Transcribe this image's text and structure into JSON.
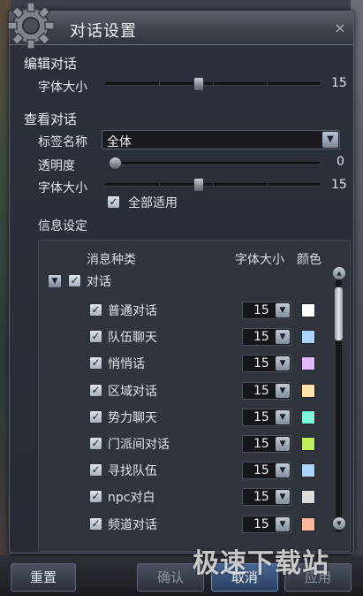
{
  "window": {
    "title": "对话设置",
    "close_glyph": "×"
  },
  "edit_chat": {
    "title": "编辑对话",
    "font_size_label": "字体大小",
    "font_size_value": "15",
    "font_size_fraction": 0.43
  },
  "view_chat": {
    "title": "查看对话",
    "tab_name_label": "标签名称",
    "tab_name_value": "全体",
    "opacity_label": "透明度",
    "opacity_value": "0",
    "opacity_fraction": 0.0,
    "font_size_label": "字体大小",
    "font_size_value": "15",
    "font_size_fraction": 0.43,
    "apply_all_label": "全部适用",
    "apply_all_checked": true
  },
  "info": {
    "title": "信息设定",
    "col_type": "消息种类",
    "col_font": "字体大小",
    "col_color": "颜色",
    "group_label": "对话",
    "group_checked": true,
    "rows": [
      {
        "label": "普通对话",
        "size": "15",
        "color": "#ffffff"
      },
      {
        "label": "队伍聊天",
        "size": "15",
        "color": "#a8d4ff"
      },
      {
        "label": "悄悄话",
        "size": "15",
        "color": "#e3b6ff"
      },
      {
        "label": "区域对话",
        "size": "15",
        "color": "#ffe3a8"
      },
      {
        "label": "势力聊天",
        "size": "15",
        "color": "#7dfbd6"
      },
      {
        "label": "门派间对话",
        "size": "15",
        "color": "#c2f05c"
      },
      {
        "label": "寻找队伍",
        "size": "15",
        "color": "#a8d4ff"
      },
      {
        "label": "npc对白",
        "size": "15",
        "color": "#dcdcdc"
      },
      {
        "label": "频道对话",
        "size": "15",
        "color": "#ffb89a"
      }
    ]
  },
  "buttons": {
    "reset": "重置",
    "confirm": "确认",
    "cancel": "取消",
    "apply": "应用"
  },
  "watermark": "极速下载站",
  "icons": {
    "check": "✓",
    "dropdown": "▼",
    "scroll_up": "▲",
    "scroll_down": "▼"
  }
}
